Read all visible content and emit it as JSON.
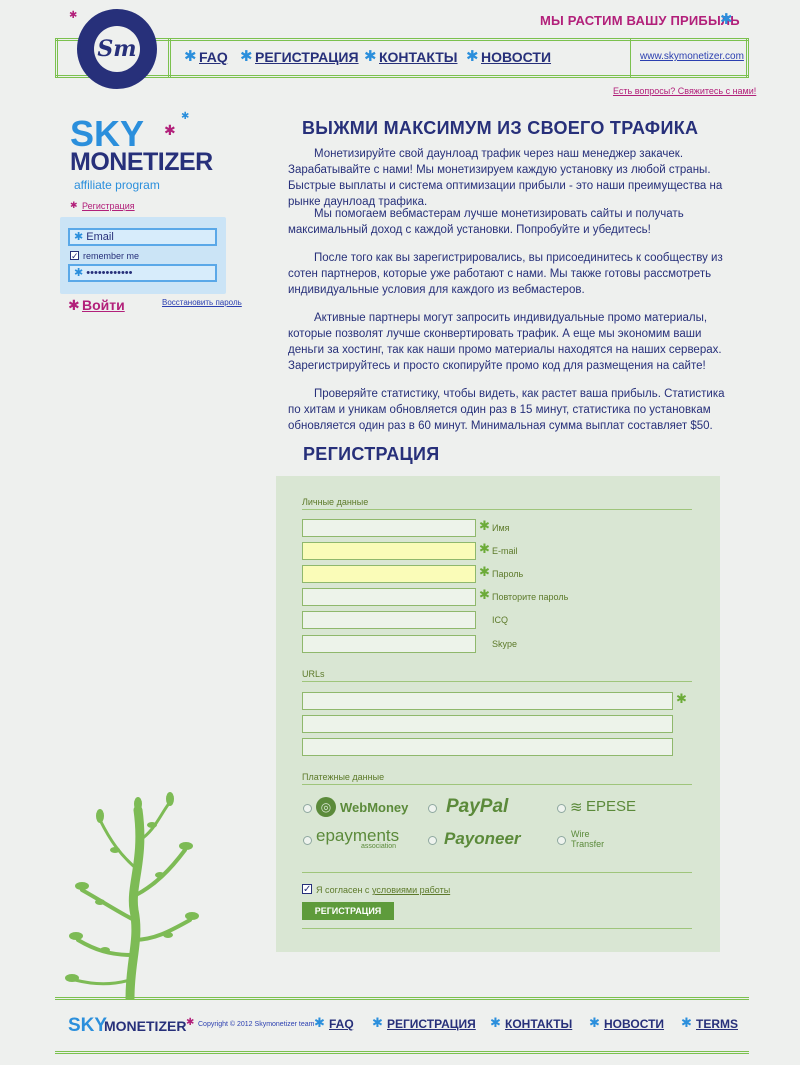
{
  "header": {
    "tagline": "МЫ РАСТИМ ВАШУ ПРИБЫЛЬ",
    "logo_text": "Sm",
    "nav": [
      "FAQ",
      "РЕГИСТРАЦИЯ",
      "КОНТАКТЫ",
      "НОВОСТИ"
    ],
    "site_link": "www.skymonetizer.com",
    "contact_link": "Есть вопросы? Свяжитесь с нами!"
  },
  "sidebar": {
    "brand_sky": "SKY",
    "brand_monetizer": "MONETIZER",
    "brand_sub": "affiliate program",
    "register_link": "Регистрация",
    "login": {
      "email_placeholder": "Email",
      "remember_label": "remember me",
      "password_value": "••••••••••••",
      "login_button": "Войти",
      "restore_link": "Восстановить пароль"
    }
  },
  "main": {
    "title": "ВЫЖМИ МАКСИМУМ ИЗ СВОЕГО ТРАФИКА",
    "paragraphs": [
      "Монетизируйте свой даунлоад трафик через наш менеджер закачек. Зарабатывайте с нами! Мы монетизируем каждую установку из любой страны. Быстрые выплаты и система оптимизации прибыли - это наши преимущества на рынке даунлоад трафика.",
      "Мы помогаем вебмастерам лучше монетизировать сайты и получать максимальный доход с каждой установки. Попробуйте и убедитесь!",
      "После того как вы зарегистрировались, вы присоединитесь к сообществу из сотен партнеров, которые уже работают с нами. Мы также готовы рассмотреть индивидуальные условия для каждого из вебмастеров.",
      "Активные партнеры могут запросить индивидуальные промо материалы, которые позволят лучше сконвертировать трафик. А еще мы экономим ваши деньги за хостинг, так как наши промо материалы находятся на наших серверах. Зарегистрируйтесь и просто скопируйте промо код для размещения на сайте!",
      "Проверяйте статистику, чтобы видеть, как растет ваша прибыль. Статистика по хитам и уникам обновляется один раз в 15 минут, статистика по установкам обновляется один раз в 60 минут. Минимальная сумма выплат составляет $50."
    ],
    "registration_title": "РЕГИСТРАЦИЯ"
  },
  "form": {
    "personal_label": "Личные данные",
    "fields": [
      "Имя",
      "E-mail",
      "Пароль",
      "Повторите пароль",
      "ICQ",
      "Skype"
    ],
    "urls_label": "URLs",
    "payment_label": "Платежные данные",
    "payments": [
      "WebMoney",
      "PayPal",
      "EPESE",
      "epayments",
      "Payoneer",
      "Wire Transfer"
    ],
    "epayments_sub": "association",
    "wire_line1": "Wire",
    "wire_line2": "Transfer",
    "agree_prefix": "Я согласен с",
    "agree_link": "условиями работы",
    "submit": "РЕГИСТРАЦИЯ"
  },
  "footer": {
    "sky": "SKY",
    "monetizer": "MONETIZER",
    "copyright": "Copyright © 2012 Skymonetizer team",
    "nav": [
      "FAQ",
      "РЕГИСТРАЦИЯ",
      "КОНТАКТЫ",
      "НОВОСТИ",
      "TERMS"
    ]
  },
  "colors": {
    "primary": "#27307a",
    "accent_blue": "#2b8fdc",
    "accent_pink": "#b2207a",
    "accent_green": "#7bc14e"
  }
}
